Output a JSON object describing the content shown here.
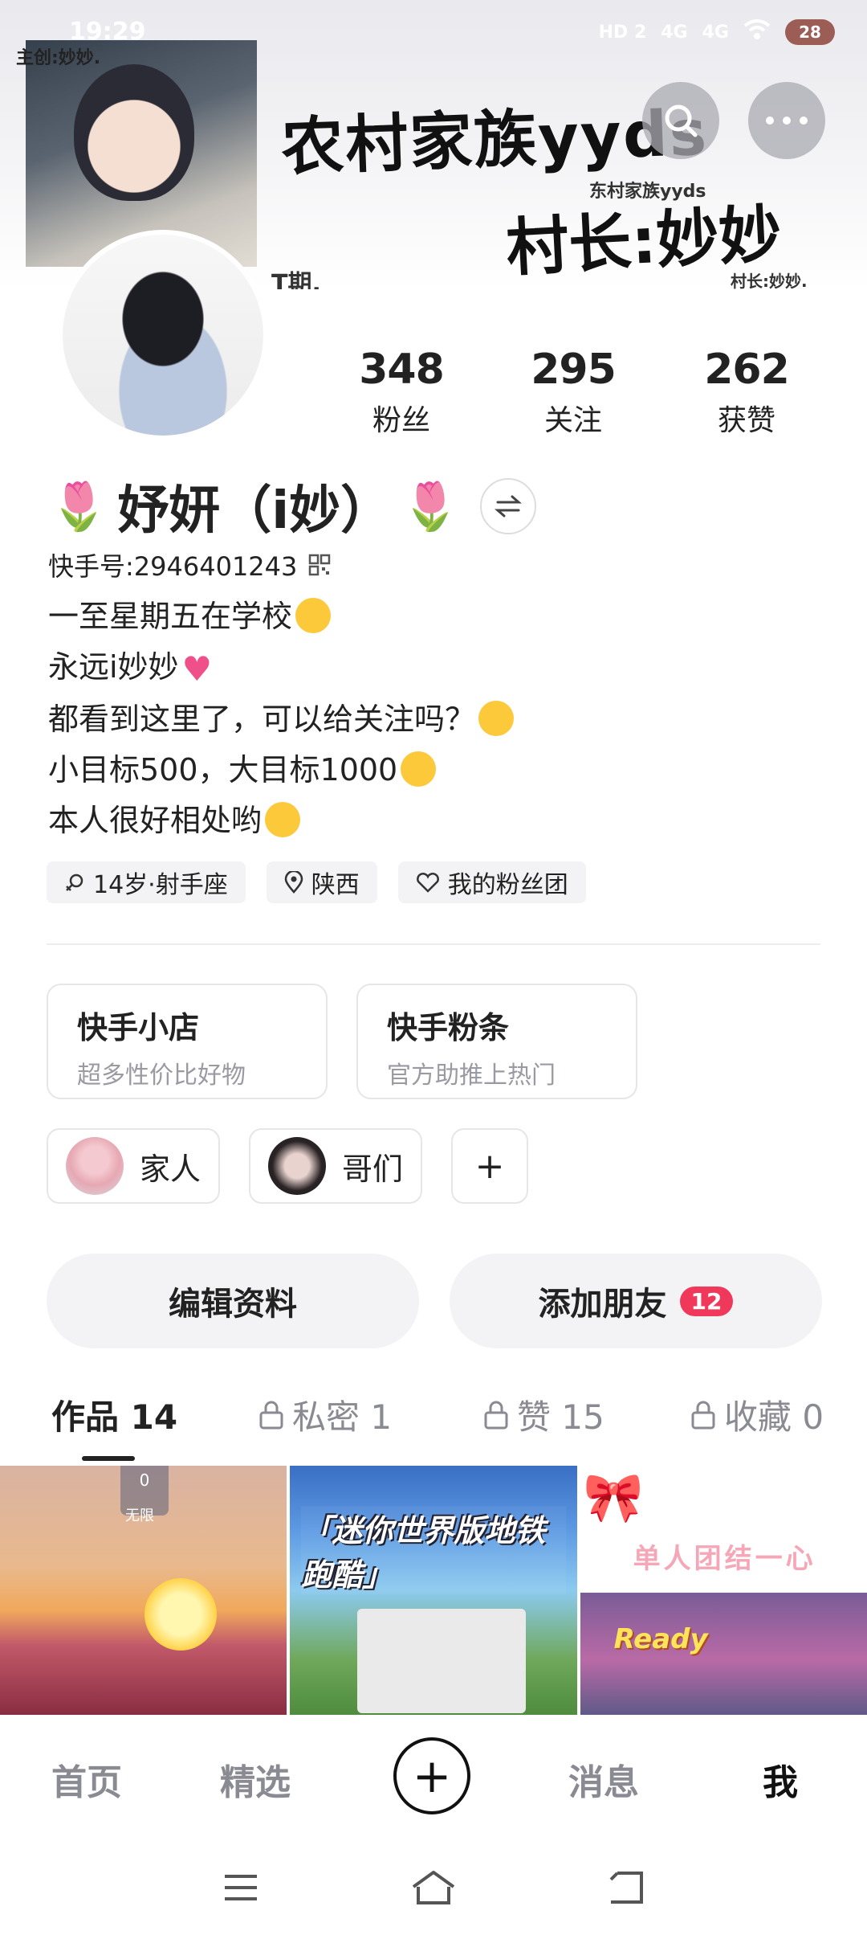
{
  "status_bar": {
    "time": "19:29",
    "author": "主创:妙妙.",
    "network": [
      "HD 2",
      "4G",
      "4G"
    ],
    "battery": "28"
  },
  "banner": {
    "title": "农村家族yyds",
    "subtitle1": "东村家族yyds",
    "title2": "村长:妙妙",
    "subtitle2": "村长:妙妙.",
    "stamp": "T期."
  },
  "header_buttons": {
    "search_icon": "search-icon",
    "more_icon": "more-icon"
  },
  "profile": {
    "stats": [
      {
        "value": "348",
        "label": "粉丝"
      },
      {
        "value": "295",
        "label": "关注"
      },
      {
        "value": "262",
        "label": "获赞"
      }
    ],
    "nickname": "妤妍（i妙）",
    "decoration": "🌷",
    "kuaishou_id": "快手号:2946401243",
    "bio": [
      "一至星期五在学校",
      "永远i妙妙",
      "都看到这里了，可以给关注吗？",
      "小目标500，大目标1000",
      "本人很好相处哟"
    ],
    "tags": [
      "14岁·射手座",
      "陕西",
      "我的粉丝团"
    ]
  },
  "shop_cards": [
    {
      "title": "快手小店",
      "subtitle": "超多性价比好物"
    },
    {
      "title": "快手粉条",
      "subtitle": "官方助推上热门"
    }
  ],
  "groups": [
    "家人",
    "哥们",
    "+"
  ],
  "actions": {
    "edit_profile": "编辑资料",
    "add_friends": "添加朋友",
    "add_friends_badge": "12"
  },
  "tabs": [
    {
      "label": "作品 14",
      "locked": false
    },
    {
      "label": "私密 1",
      "locked": true
    },
    {
      "label": "赞 15",
      "locked": true
    },
    {
      "label": "收藏 0",
      "locked": true
    }
  ],
  "grid": {
    "cell1_hud": "0",
    "cell1_hud_label": "无限",
    "cell2_caption": "「迷你世界版地铁跑酷」",
    "cell3_title": "单人团结一心",
    "cell3_ready": "Ready"
  },
  "bottom_nav": {
    "home": "首页",
    "featured": "精选",
    "plus": "+",
    "messages": "消息",
    "me": "我"
  },
  "colors": {
    "accent_red": "#f0385a",
    "text_dark": "#222222",
    "text_muted": "#8a8a92"
  }
}
